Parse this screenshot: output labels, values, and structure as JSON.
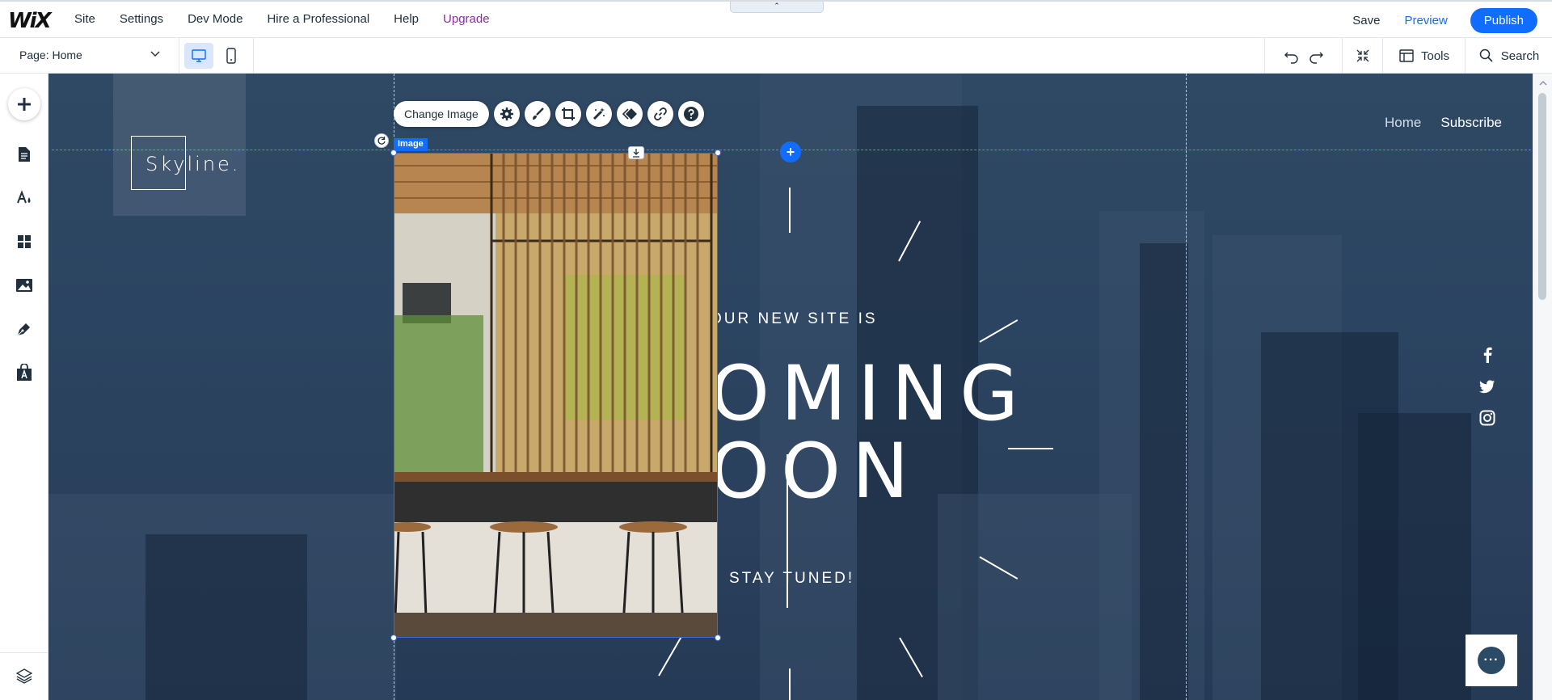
{
  "editor": {
    "logo": "WiX",
    "menu": [
      "Site",
      "Settings",
      "Dev Mode",
      "Hire a Professional",
      "Help",
      "Upgrade"
    ],
    "collapse_arrow": "⌃",
    "save_label": "Save",
    "preview_label": "Preview",
    "publish_label": "Publish",
    "page_selector": "Page: Home",
    "tools_label": "Tools",
    "search_label": "Search",
    "accent_color": "#116dff"
  },
  "sidebar": {
    "icons": [
      "add-icon",
      "pages-icon",
      "design-icon",
      "apps-icon",
      "media-icon",
      "blog-icon",
      "store-icon",
      "layers-icon"
    ]
  },
  "site": {
    "logo_text": "Skyline.",
    "nav": [
      "Home",
      "Subscribe"
    ],
    "hero_small": "OUR NEW SITE IS",
    "hero_big_line1": "OMING",
    "hero_big_line2": "OON",
    "hero_tuned": "STAY TUNED!",
    "social": [
      "facebook-icon",
      "twitter-icon",
      "instagram-icon"
    ]
  },
  "selection": {
    "label": "Image",
    "toolbar_primary": "Change Image",
    "toolbar_icons": [
      "settings-icon",
      "design-brush-icon",
      "crop-icon",
      "enhance-icon",
      "animation-icon",
      "link-icon",
      "help-icon"
    ]
  }
}
